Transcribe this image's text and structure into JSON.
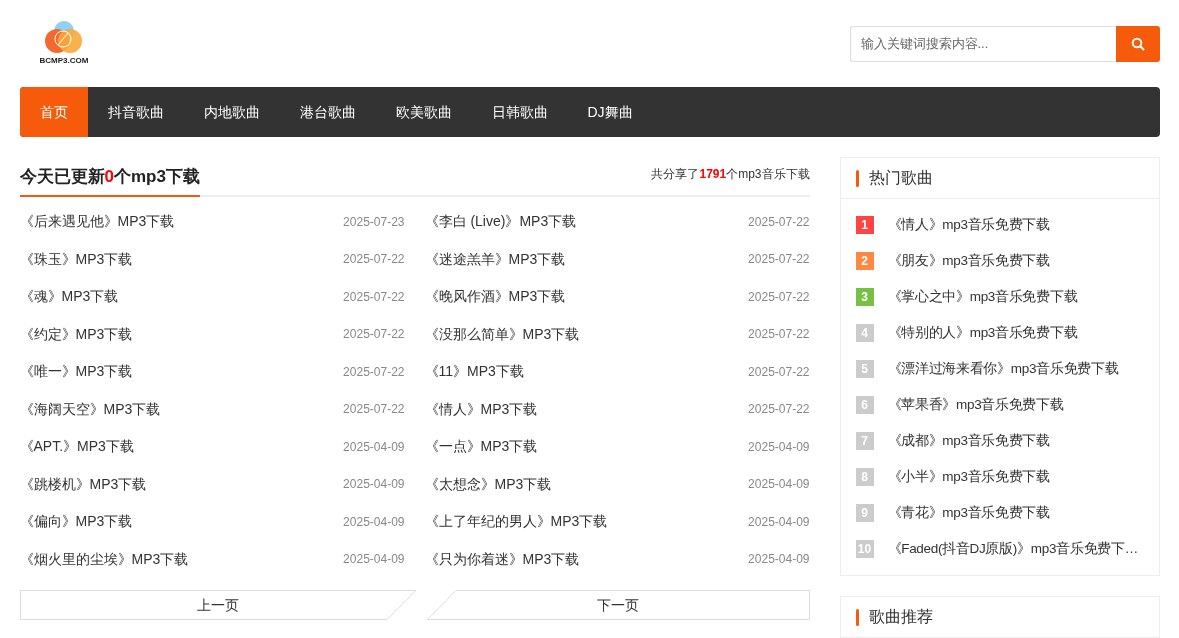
{
  "logo": {
    "text": "BCMP3.COM"
  },
  "search": {
    "placeholder": "输入关键词搜索内容..."
  },
  "nav": [
    {
      "label": "首页",
      "selected": true
    },
    {
      "label": "抖音歌曲",
      "selected": false
    },
    {
      "label": "内地歌曲",
      "selected": false
    },
    {
      "label": "港台歌曲",
      "selected": false
    },
    {
      "label": "欧美歌曲",
      "selected": false
    },
    {
      "label": "日韩歌曲",
      "selected": false
    },
    {
      "label": "DJ舞曲",
      "selected": false
    }
  ],
  "updates": {
    "title_prefix": "今天已更新",
    "title_count": "0",
    "title_suffix": "个mp3下载",
    "total_prefix": "共分享了",
    "total_count": "1791",
    "total_suffix": "个mp3音乐下载"
  },
  "songs": [
    {
      "title": "《后来遇见他》MP3下载",
      "date": "2025-07-23"
    },
    {
      "title": "《李白 (Live)》MP3下载",
      "date": "2025-07-22"
    },
    {
      "title": "《珠玉》MP3下载",
      "date": "2025-07-22"
    },
    {
      "title": "《迷途羔羊》MP3下载",
      "date": "2025-07-22"
    },
    {
      "title": "《魂》MP3下载",
      "date": "2025-07-22"
    },
    {
      "title": "《晚风作酒》MP3下载",
      "date": "2025-07-22"
    },
    {
      "title": "《约定》MP3下载",
      "date": "2025-07-22"
    },
    {
      "title": "《没那么简单》MP3下载",
      "date": "2025-07-22"
    },
    {
      "title": "《唯一》MP3下载",
      "date": "2025-07-22"
    },
    {
      "title": "《11》MP3下载",
      "date": "2025-07-22"
    },
    {
      "title": "《海阔天空》MP3下载",
      "date": "2025-07-22"
    },
    {
      "title": "《情人》MP3下载",
      "date": "2025-07-22"
    },
    {
      "title": "《APT.》MP3下载",
      "date": "2025-04-09"
    },
    {
      "title": "《一点》MP3下载",
      "date": "2025-04-09"
    },
    {
      "title": "《跳楼机》MP3下载",
      "date": "2025-04-09"
    },
    {
      "title": "《太想念》MP3下载",
      "date": "2025-04-09"
    },
    {
      "title": "《偏向》MP3下载",
      "date": "2025-04-09"
    },
    {
      "title": "《上了年纪的男人》MP3下载",
      "date": "2025-04-09"
    },
    {
      "title": "《烟火里的尘埃》MP3下载",
      "date": "2025-04-09"
    },
    {
      "title": "《只为你着迷》MP3下载",
      "date": "2025-04-09"
    }
  ],
  "pagination": {
    "prev": "上一页",
    "next": "下一页"
  },
  "hot": {
    "title": "热门歌曲",
    "items": [
      {
        "rank": "1",
        "title": "《情人》mp3音乐免费下载",
        "color": "#ff4444"
      },
      {
        "rank": "2",
        "title": "《朋友》mp3音乐免费下载",
        "color": "#ff8844"
      },
      {
        "rank": "3",
        "title": "《掌心之中》mp3音乐免费下载",
        "color": "#77c044"
      },
      {
        "rank": "4",
        "title": "《特别的人》mp3音乐免费下载",
        "color": "#cccccc"
      },
      {
        "rank": "5",
        "title": "《漂洋过海来看你》mp3音乐免费下载",
        "color": "#cccccc"
      },
      {
        "rank": "6",
        "title": "《苹果香》mp3音乐免费下载",
        "color": "#cccccc"
      },
      {
        "rank": "7",
        "title": "《成都》mp3音乐免费下载",
        "color": "#cccccc"
      },
      {
        "rank": "8",
        "title": "《小半》mp3音乐免费下载",
        "color": "#cccccc"
      },
      {
        "rank": "9",
        "title": "《青花》mp3音乐免费下载",
        "color": "#cccccc"
      },
      {
        "rank": "10",
        "title": "《Faded(抖音DJ原版)》mp3音乐免费下…",
        "color": "#cccccc"
      }
    ]
  },
  "recommend": {
    "title": "歌曲推荐"
  }
}
